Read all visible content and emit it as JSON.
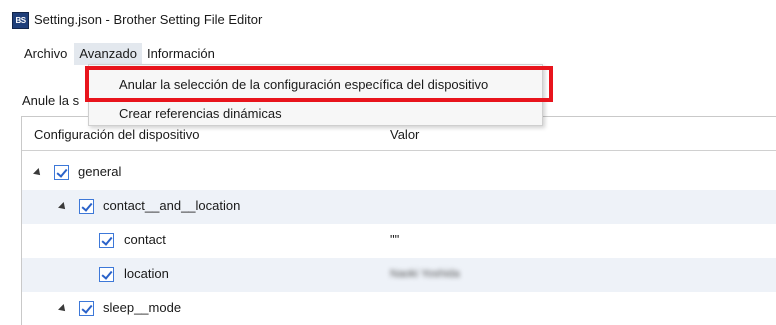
{
  "window": {
    "title": "Setting.json - Brother Setting File Editor",
    "icon": "app-icon-bse"
  },
  "menubar": {
    "items": [
      {
        "label": "Archivo"
      },
      {
        "label": "Avanzado"
      },
      {
        "label": "Información"
      }
    ]
  },
  "dropdown": {
    "items": [
      {
        "label": "Anular la selección de la configuración específica del dispositivo"
      },
      {
        "label": "Crear referencias dinámicas"
      }
    ]
  },
  "hint": {
    "text": "Anule la s"
  },
  "tree": {
    "columns": {
      "config": "Configuración del dispositivo",
      "value": "Valor"
    },
    "rows": [
      {
        "label": "general",
        "value": "",
        "checked": true
      },
      {
        "label": "contact__and__location",
        "value": "",
        "checked": true
      },
      {
        "label": "contact",
        "value": "\"\"",
        "checked": true
      },
      {
        "label": "location",
        "value": "Naoki Yoshida",
        "checked": true
      },
      {
        "label": "sleep__mode",
        "value": "",
        "checked": true
      }
    ]
  },
  "colors": {
    "highlight_border": "#e8141c",
    "checkbox": "#2a62c9",
    "alt_row": "#eef2f8",
    "active_menu": "#e3e8ee"
  }
}
